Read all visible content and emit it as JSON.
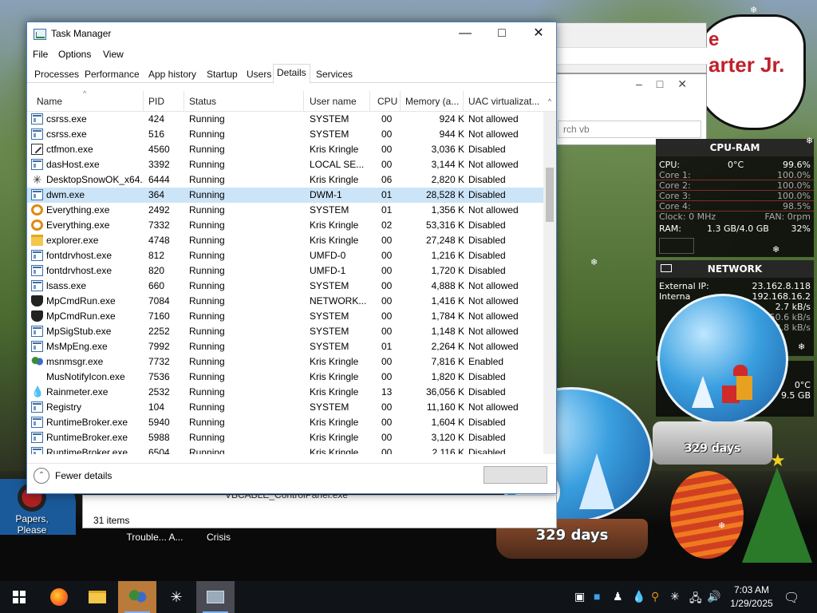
{
  "desktop": {
    "icons": [
      {
        "label": "Papers, Please"
      },
      {
        "label": "Trouble... A..."
      },
      {
        "label": "Crisis"
      }
    ],
    "speech_bubble_text": "arter Jr.",
    "speech_bubble_top": "e",
    "background_window": {
      "search_placeholder": "rch vb",
      "filename": "VBCABLE_ControlPanel.exe",
      "items_count": "31 items"
    }
  },
  "task_manager": {
    "title": "Task Manager",
    "menu": [
      "File",
      "Options",
      "View"
    ],
    "tabs": [
      "Processes",
      "Performance",
      "App history",
      "Startup",
      "Users",
      "Details",
      "Services"
    ],
    "selected_tab": "Details",
    "columns": [
      "Name",
      "PID",
      "Status",
      "User name",
      "CPU",
      "Memory (a...",
      "UAC virtualizat..."
    ],
    "rows": [
      {
        "icon": "window-icon",
        "name": "csrss.exe",
        "pid": "424",
        "status": "Running",
        "user": "SYSTEM",
        "cpu": "00",
        "memory": "924 K",
        "uac": "Not allowed"
      },
      {
        "icon": "window-icon",
        "name": "csrss.exe",
        "pid": "516",
        "status": "Running",
        "user": "SYSTEM",
        "cpu": "00",
        "memory": "944 K",
        "uac": "Not allowed"
      },
      {
        "icon": "pen-icon",
        "name": "ctfmon.exe",
        "pid": "4560",
        "status": "Running",
        "user": "Kris Kringle",
        "cpu": "00",
        "memory": "3,036 K",
        "uac": "Disabled"
      },
      {
        "icon": "window-icon",
        "name": "dasHost.exe",
        "pid": "3392",
        "status": "Running",
        "user": "LOCAL SE...",
        "cpu": "00",
        "memory": "3,144 K",
        "uac": "Not allowed"
      },
      {
        "icon": "snowflake-icon",
        "name": "DesktopSnowOK_x64...",
        "pid": "6444",
        "status": "Running",
        "user": "Kris Kringle",
        "cpu": "06",
        "memory": "2,820 K",
        "uac": "Disabled"
      },
      {
        "icon": "window-icon",
        "name": "dwm.exe",
        "pid": "364",
        "status": "Running",
        "user": "DWM-1",
        "cpu": "01",
        "memory": "28,528 K",
        "uac": "Disabled"
      },
      {
        "icon": "magnifier-icon",
        "name": "Everything.exe",
        "pid": "2492",
        "status": "Running",
        "user": "SYSTEM",
        "cpu": "01",
        "memory": "1,356 K",
        "uac": "Not allowed"
      },
      {
        "icon": "magnifier-icon",
        "name": "Everything.exe",
        "pid": "7332",
        "status": "Running",
        "user": "Kris Kringle",
        "cpu": "02",
        "memory": "53,316 K",
        "uac": "Disabled"
      },
      {
        "icon": "folder-icon",
        "name": "explorer.exe",
        "pid": "4748",
        "status": "Running",
        "user": "Kris Kringle",
        "cpu": "00",
        "memory": "27,248 K",
        "uac": "Disabled"
      },
      {
        "icon": "window-icon",
        "name": "fontdrvhost.exe",
        "pid": "812",
        "status": "Running",
        "user": "UMFD-0",
        "cpu": "00",
        "memory": "1,216 K",
        "uac": "Disabled"
      },
      {
        "icon": "window-icon",
        "name": "fontdrvhost.exe",
        "pid": "820",
        "status": "Running",
        "user": "UMFD-1",
        "cpu": "00",
        "memory": "1,720 K",
        "uac": "Disabled"
      },
      {
        "icon": "window-icon",
        "name": "lsass.exe",
        "pid": "660",
        "status": "Running",
        "user": "SYSTEM",
        "cpu": "00",
        "memory": "4,888 K",
        "uac": "Not allowed"
      },
      {
        "icon": "shield-icon",
        "name": "MpCmdRun.exe",
        "pid": "7084",
        "status": "Running",
        "user": "NETWORK...",
        "cpu": "00",
        "memory": "1,416 K",
        "uac": "Not allowed"
      },
      {
        "icon": "shield-icon",
        "name": "MpCmdRun.exe",
        "pid": "7160",
        "status": "Running",
        "user": "SYSTEM",
        "cpu": "00",
        "memory": "1,784 K",
        "uac": "Not allowed"
      },
      {
        "icon": "window-icon",
        "name": "MpSigStub.exe",
        "pid": "2252",
        "status": "Running",
        "user": "SYSTEM",
        "cpu": "00",
        "memory": "1,148 K",
        "uac": "Not allowed"
      },
      {
        "icon": "window-icon",
        "name": "MsMpEng.exe",
        "pid": "7992",
        "status": "Running",
        "user": "SYSTEM",
        "cpu": "01",
        "memory": "2,264 K",
        "uac": "Not allowed"
      },
      {
        "icon": "people-icon",
        "name": "msnmsgr.exe",
        "pid": "7732",
        "status": "Running",
        "user": "Kris Kringle",
        "cpu": "00",
        "memory": "7,816 K",
        "uac": "Enabled"
      },
      {
        "icon": "none",
        "name": "MusNotifyIcon.exe",
        "pid": "7536",
        "status": "Running",
        "user": "Kris Kringle",
        "cpu": "00",
        "memory": "1,820 K",
        "uac": "Disabled"
      },
      {
        "icon": "drop-icon",
        "name": "Rainmeter.exe",
        "pid": "2532",
        "status": "Running",
        "user": "Kris Kringle",
        "cpu": "13",
        "memory": "36,056 K",
        "uac": "Disabled"
      },
      {
        "icon": "window-icon",
        "name": "Registry",
        "pid": "104",
        "status": "Running",
        "user": "SYSTEM",
        "cpu": "00",
        "memory": "11,160 K",
        "uac": "Not allowed"
      },
      {
        "icon": "window-icon",
        "name": "RuntimeBroker.exe",
        "pid": "5940",
        "status": "Running",
        "user": "Kris Kringle",
        "cpu": "00",
        "memory": "1,604 K",
        "uac": "Disabled"
      },
      {
        "icon": "window-icon",
        "name": "RuntimeBroker.exe",
        "pid": "5988",
        "status": "Running",
        "user": "Kris Kringle",
        "cpu": "00",
        "memory": "3,120 K",
        "uac": "Disabled"
      },
      {
        "icon": "window-icon",
        "name": "RuntimeBroker.exe",
        "pid": "6504",
        "status": "Running",
        "user": "Kris Kringle",
        "cpu": "00",
        "memory": "2,116 K",
        "uac": "Disabled"
      }
    ],
    "selected_row": 5,
    "footer_label": "Fewer details"
  },
  "widgets": {
    "cpu_ram": {
      "title": "CPU-RAM",
      "cpu_label": "CPU:",
      "cpu_temp": "0°C",
      "cpu_total": "99.6%",
      "cores": [
        {
          "label": "Core 1:",
          "value": "100.0%"
        },
        {
          "label": "Core 2:",
          "value": "100.0%"
        },
        {
          "label": "Core 3:",
          "value": "100.0%"
        },
        {
          "label": "Core 4:",
          "value": "98.5%"
        }
      ],
      "clock": "Clock: 0 MHz",
      "fan": "FAN: 0rpm",
      "ram_label": "RAM:",
      "ram_value": "1.3 GB/4.0 GB",
      "ram_pct": "32%"
    },
    "network": {
      "title": "NETWORK",
      "external_label": "External IP:",
      "external_ip": "23.162.8.118",
      "internal_label": "Interna",
      "internal_ip": "192.168.16.2",
      "rate1": "2.7 kB/s",
      "rate2": "50.6 kB/s",
      "rate3": "22.8 kB/s"
    },
    "disk": {
      "temp": "0°C",
      "size": "9.5 GB"
    }
  },
  "globes": {
    "label": "329 days"
  },
  "taskbar": {
    "time": "7:03 AM",
    "date": "1/29/2025"
  },
  "colors": {
    "selection": "#cce4f7",
    "taskbar": "#101418",
    "accent": "#0078d7"
  }
}
